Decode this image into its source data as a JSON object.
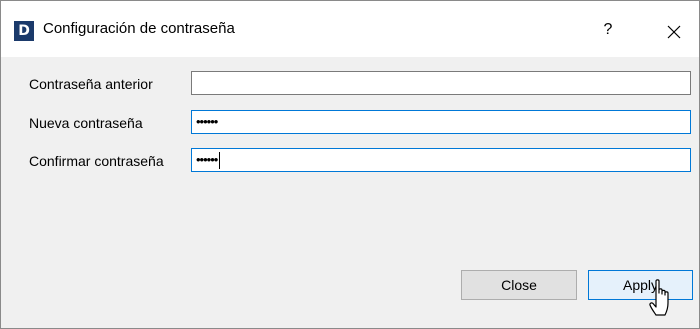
{
  "window": {
    "title": "Configuración de contraseña",
    "logo_letter": "D",
    "help_label": "?"
  },
  "form": {
    "fields": [
      {
        "label": "Contraseña anterior",
        "value": ""
      },
      {
        "label": "Nueva contraseña",
        "value": "••••••"
      },
      {
        "label": "Confirmar contraseña",
        "value": "••••••"
      }
    ]
  },
  "buttons": {
    "close_label": "Close",
    "apply_label": "Apply"
  },
  "colors": {
    "logo_bg": "#1b3a6b",
    "focus_border": "#0078d7"
  },
  "icons": {
    "app": "app-logo-icon",
    "help": "help-icon",
    "close": "close-icon",
    "cursor": "hand-pointer-icon"
  }
}
